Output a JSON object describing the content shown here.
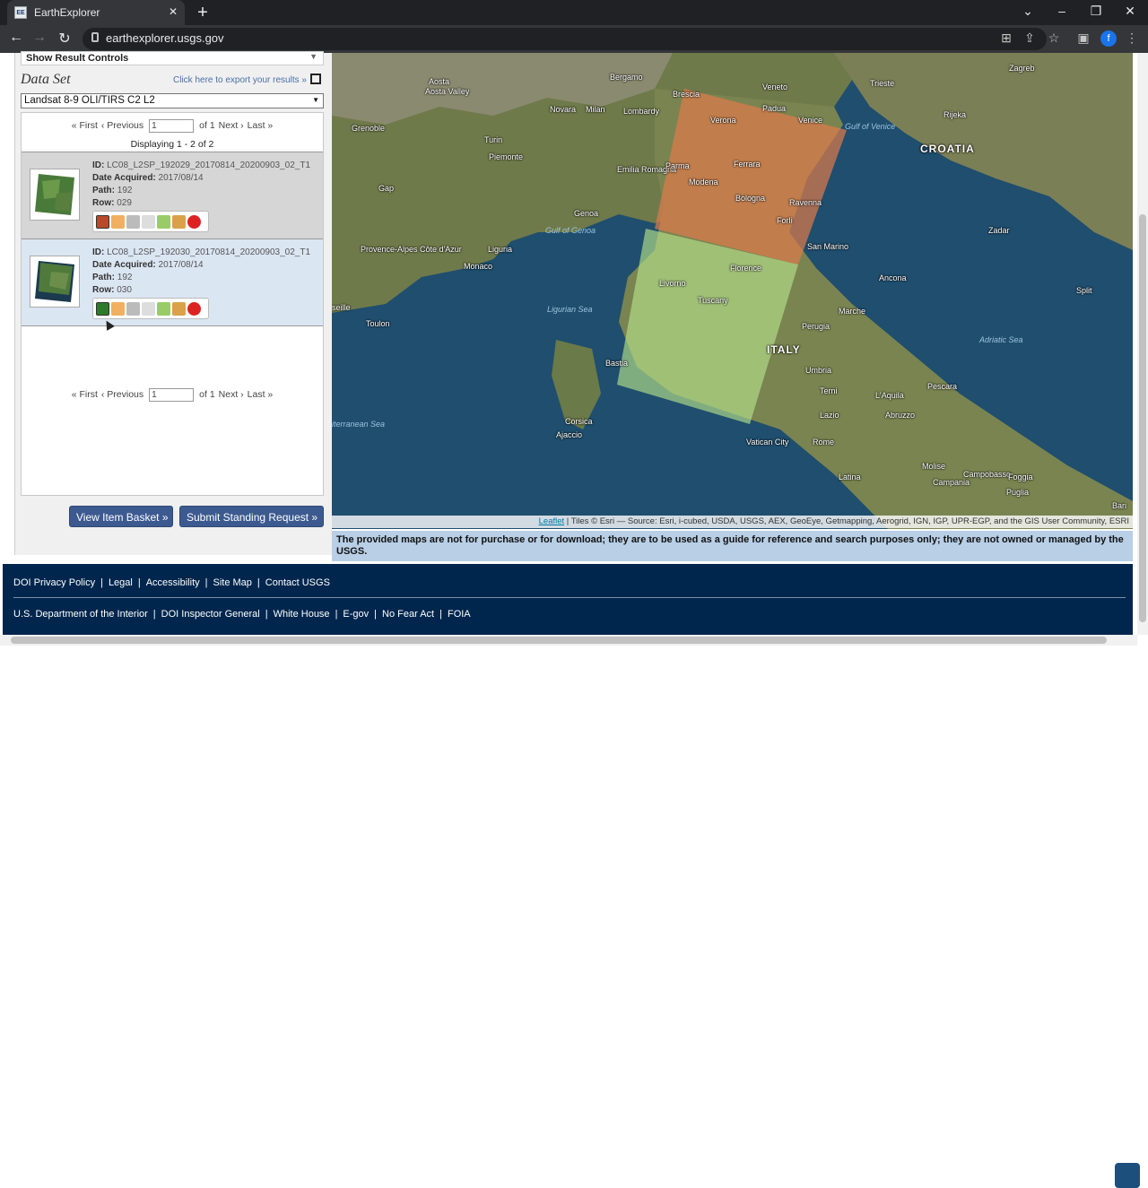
{
  "browser": {
    "tab_title": "EarthExplorer",
    "favicon_text": "EE",
    "url": "earthexplorer.usgs.gov",
    "profile_initial": "f"
  },
  "panel": {
    "result_controls": "Show Result Controls",
    "dataset_title": "Data Set",
    "export_link": "Click here to export your results »",
    "dataset_value": "Landsat 8-9 OLI/TIRS C2 L2",
    "pager": {
      "first": "« First",
      "previous": "‹ Previous",
      "page": "1",
      "of": "of 1",
      "next": "Next ›",
      "last": "Last »"
    },
    "displaying": "Displaying 1 - 2 of 2",
    "results": [
      {
        "id_label": "ID:",
        "id": "LC08_L2SP_192029_20170814_20200903_02_T1",
        "date_label": "Date Acquired:",
        "date": "2017/08/14",
        "path_label": "Path:",
        "path": "192",
        "row_label": "Row:",
        "row": "029"
      },
      {
        "id_label": "ID:",
        "id": "LC08_L2SP_192030_20170814_20200903_02_T1",
        "date_label": "Date Acquired:",
        "date": "2017/08/14",
        "path_label": "Path:",
        "path": "192",
        "row_label": "Row:",
        "row": "030"
      }
    ],
    "btn_basket": "View Item Basket »",
    "btn_standing": "Submit Standing Request »"
  },
  "map": {
    "labels": [
      "Bergamo",
      "Brescia",
      "Veneto",
      "Trieste",
      "Zagreb",
      "Aosta",
      "Aosta Valley",
      "Novara",
      "Milan",
      "Lombardy",
      "Verona",
      "Padua",
      "Venice",
      "Gulf of Venice",
      "Rijeka",
      "Grenoble",
      "Turin",
      "Piemonte",
      "Emilia Romagna",
      "Parma",
      "Modena",
      "Ferrara",
      "Bologna",
      "Ravenna",
      "Forlì",
      "CROATIA",
      "Gap",
      "Genoa",
      "Gulf of Genoa",
      "Liguria",
      "Provence-Alpes Côte d'Azur",
      "Monaco",
      "San Marino",
      "Florence",
      "Zadar",
      "Livorno",
      "Tuscany",
      "Ancona",
      "Split",
      "Ligurian Sea",
      "Marche",
      "Perugia",
      "Umbria",
      "ITALY",
      "Adriatic Sea",
      "Toulon",
      "Bastia",
      "Terni",
      "L'Aquila",
      "Pescara",
      "Corsica",
      "Ajaccio",
      "Lazio",
      "Abruzzo",
      "Vatican City",
      "Rome",
      "Molise",
      "Campobasso",
      "Foggia",
      "Latina",
      "Puglia",
      "Campania",
      "Bari",
      "iterranean Sea",
      "seille"
    ],
    "attribution_link": "Leaflet",
    "attribution": " | Tiles © Esri — Source: Esri, i-cubed, USDA, USGS, AEX, GeoEye, Getmapping, Aerogrid, IGN, IGP, UPR-EGP, and the GIS User Community, ESRI",
    "disclaimer_pre": "The provided maps are not for purchase or for download; they are to be used as a guide for reference and search purposes only; they are not owned or managed by the ",
    "disclaimer_bold": "USGS",
    "disclaimer_end": "."
  },
  "footer": {
    "row1": [
      "DOI Privacy Policy",
      "Legal",
      "Accessibility",
      "Site Map",
      "Contact USGS"
    ],
    "row2": [
      "U.S. Department of the Interior",
      "DOI Inspector General",
      "White House",
      "E-gov",
      "No Fear Act",
      "FOIA"
    ]
  },
  "colors": {
    "footer": "#00264d",
    "button": "#3c5a8f",
    "footprint1": "#e07a4a",
    "footprint2": "#b6e08a"
  }
}
